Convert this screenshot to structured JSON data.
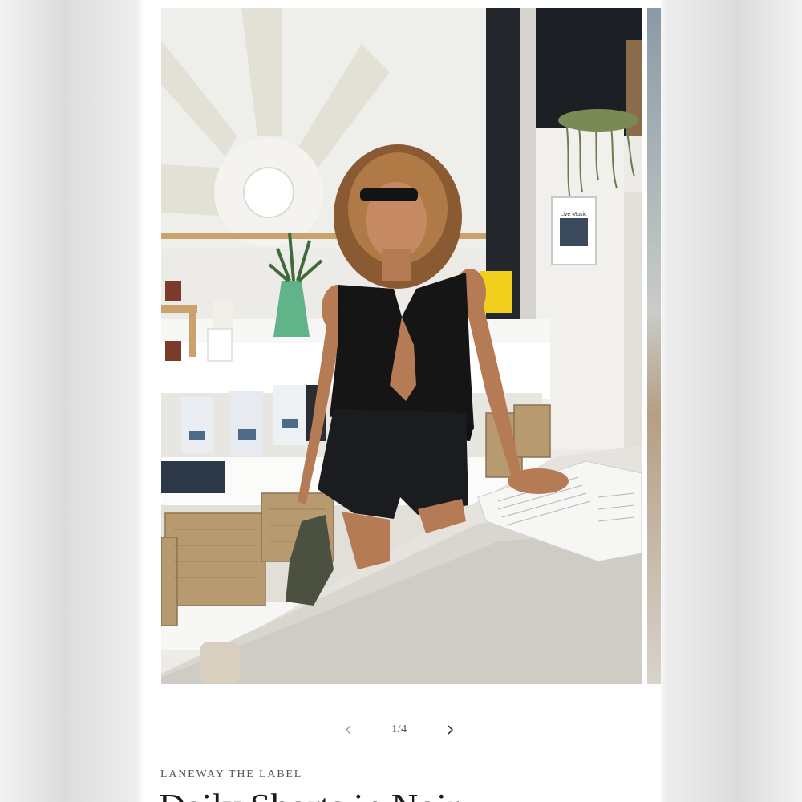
{
  "gallery": {
    "counter": "1/4",
    "current": 1,
    "total": 4,
    "prev_icon": "chevron-left-icon",
    "next_icon": "chevron-right-icon"
  },
  "product": {
    "vendor": "LANEWAY THE LABEL",
    "title_partial": "Daily Shorts in Noir"
  },
  "photo": {
    "poster_text": "Live Music"
  },
  "colors": {
    "page_bg": "#ffffff",
    "text_primary": "#1a1a1a",
    "text_secondary": "#555555"
  }
}
